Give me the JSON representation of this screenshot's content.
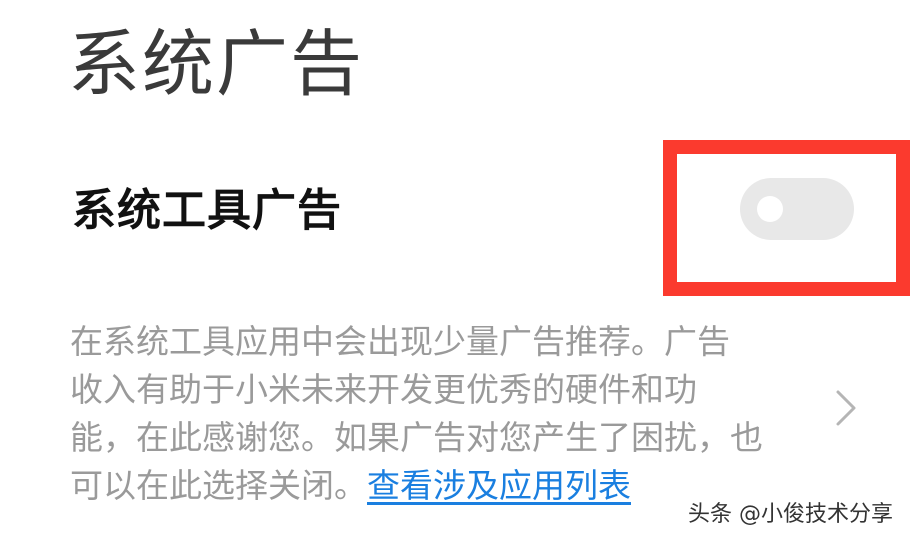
{
  "header": {
    "title": "系统广告"
  },
  "setting": {
    "label": "系统工具广告",
    "toggle_state": "off"
  },
  "description": {
    "lines": [
      "在系统工具应用中会出现少量广告推荐。广告",
      "收入有助于小米未来开发更优秀的硬件和功",
      "能，在此感谢您。如果广告对您产生了困扰，也"
    ],
    "last_line_prefix": "可以在此选择关闭。",
    "link_text": "查看涉及应用列表"
  },
  "watermark": {
    "text": "头条 @小俊技术分享"
  },
  "colors": {
    "highlight_box": "#fb3a2e",
    "link": "#1a7fe0",
    "toggle_track": "#e8e8e8"
  },
  "icons": {
    "chevron": "chevron-right-icon"
  }
}
